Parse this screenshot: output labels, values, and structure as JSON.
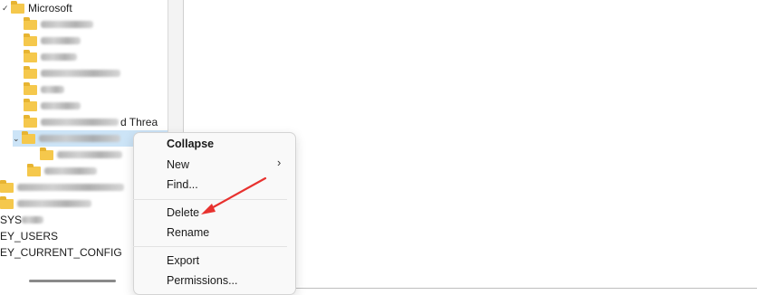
{
  "tree": {
    "microsoft_label": "Microsoft",
    "visible_text_nodes": [
      "SYS",
      "EY_USERS",
      "EY_CURRENT_CONFIG"
    ],
    "partial_label": "d Threa"
  },
  "context_menu": {
    "items": [
      {
        "label": "Collapse"
      },
      {
        "label": "New"
      },
      {
        "label": "Find..."
      },
      {
        "label": "Delete"
      },
      {
        "label": "Rename"
      },
      {
        "label": "Export"
      },
      {
        "label": "Permissions..."
      }
    ],
    "submenu_arrow": "›"
  },
  "colors": {
    "annotation_arrow": "#e8322f",
    "folder": "#f5c84c",
    "selection": "#cce4f7"
  }
}
